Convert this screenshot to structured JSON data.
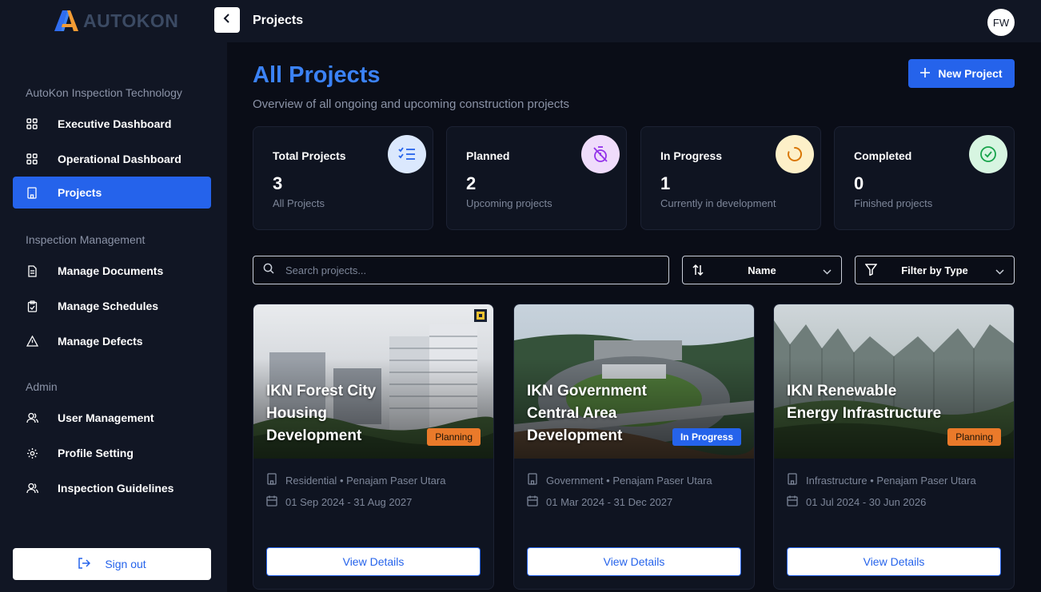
{
  "brand": {
    "name": "AUTOKON"
  },
  "header": {
    "title": "Projects",
    "user_initials": "FW"
  },
  "sidebar": {
    "sections": [
      {
        "title": "AutoKon Inspection Technology"
      },
      {
        "title": "Inspection Management"
      },
      {
        "title": "Admin"
      }
    ],
    "items": [
      {
        "label": "Executive Dashboard",
        "icon": "grid-icon"
      },
      {
        "label": "Operational Dashboard",
        "icon": "grid-icon"
      },
      {
        "label": "Projects",
        "icon": "building-icon",
        "active": true
      },
      {
        "label": "Manage Documents",
        "icon": "document-icon"
      },
      {
        "label": "Manage Schedules",
        "icon": "clipboard-icon"
      },
      {
        "label": "Manage Defects",
        "icon": "warning-icon"
      },
      {
        "label": "User Management",
        "icon": "users-icon"
      },
      {
        "label": "Profile Setting",
        "icon": "gear-icon"
      },
      {
        "label": "Inspection Guidelines",
        "icon": "users-icon"
      }
    ],
    "sign_out": "Sign out"
  },
  "main": {
    "title": "All Projects",
    "subtitle": "Overview of all ongoing and upcoming construction projects",
    "new_button": "New Project",
    "stats": [
      {
        "label": "Total Projects",
        "value": "3",
        "desc": "All Projects",
        "icon": "checklist-icon",
        "bg": "#dbe8fd",
        "fg": "#2563eb"
      },
      {
        "label": "Planned",
        "value": "2",
        "desc": "Upcoming projects",
        "icon": "timer-off-icon",
        "bg": "#efdcfb",
        "fg": "#9333ea"
      },
      {
        "label": "In Progress",
        "value": "1",
        "desc": "Currently in development",
        "icon": "loader-icon",
        "bg": "#fdf0c8",
        "fg": "#d97706"
      },
      {
        "label": "Completed",
        "value": "0",
        "desc": "Finished projects",
        "icon": "check-circle-icon",
        "bg": "#d7f5e1",
        "fg": "#16a34a"
      }
    ],
    "search": {
      "placeholder": "Search projects..."
    },
    "sort": {
      "value": "Name"
    },
    "filter": {
      "value": "Filter by Type"
    },
    "projects": [
      {
        "title": "IKN Forest City Housing Development",
        "status": "Planning",
        "type": "Residential",
        "location": "Penajam Paser Utara",
        "dates": "01 Sep 2024 - 31 Aug 2027",
        "button": "View Details"
      },
      {
        "title": "IKN Government Central Area Development",
        "status": "In Progress",
        "type": "Government",
        "location": "Penajam Paser Utara",
        "dates": "01 Mar 2024 - 31 Dec 2027",
        "button": "View Details"
      },
      {
        "title": "IKN Renewable Energy Infrastructure",
        "status": "Planning",
        "type": "Infrastructure",
        "location": "Penajam Paser Utara",
        "dates": "01 Jul 2024 - 30 Jun 2026",
        "button": "View Details"
      }
    ],
    "meta_separator": "•"
  }
}
